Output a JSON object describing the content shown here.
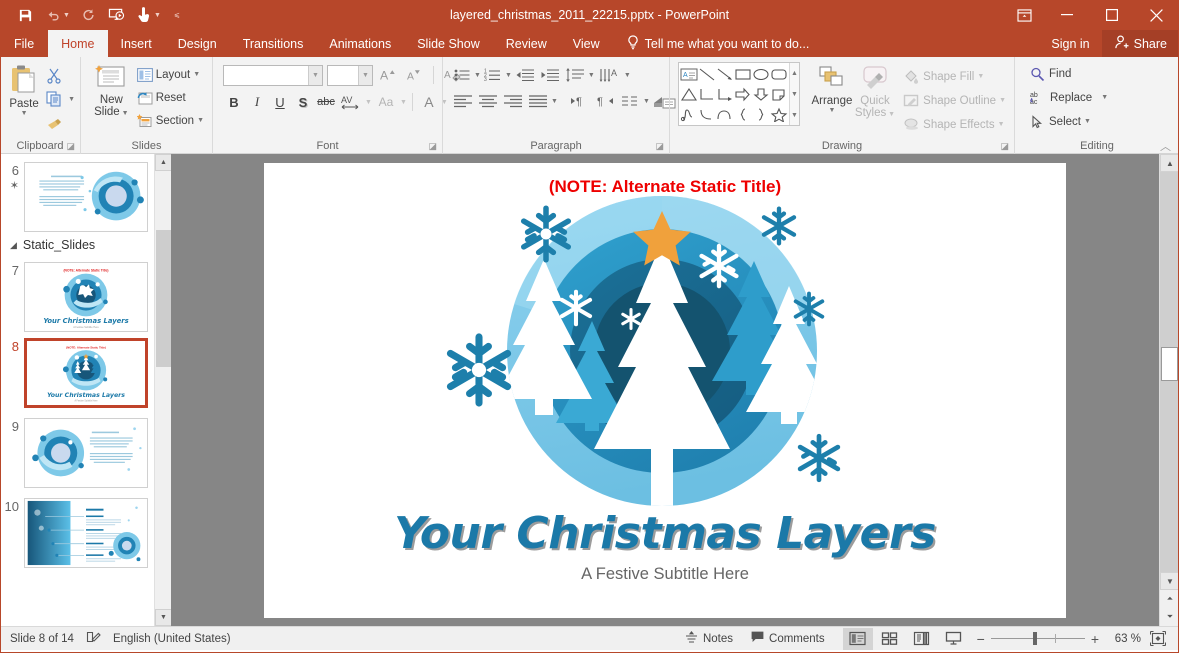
{
  "app": {
    "title": "layered_christmas_2011_22215.pptx - PowerPoint",
    "accent": "#b7472a"
  },
  "quick_access": [
    {
      "name": "save-icon",
      "glyph": "💾",
      "enabled": true
    },
    {
      "name": "undo-icon",
      "glyph": "↶",
      "enabled": false
    },
    {
      "name": "redo-icon",
      "glyph": "↻",
      "enabled": false
    },
    {
      "name": "start-presentation-icon",
      "glyph": "▶",
      "enabled": true
    },
    {
      "name": "touch-mode-icon",
      "glyph": "☝",
      "enabled": true
    }
  ],
  "window_controls": {
    "ribbon_display_options": "Ribbon Display Options",
    "minimize": "Minimize",
    "restore": "Restore Down",
    "close": "Close"
  },
  "tabs": [
    {
      "label": "File",
      "active": false,
      "file": true
    },
    {
      "label": "Home",
      "active": true
    },
    {
      "label": "Insert",
      "active": false
    },
    {
      "label": "Design",
      "active": false
    },
    {
      "label": "Transitions",
      "active": false
    },
    {
      "label": "Animations",
      "active": false
    },
    {
      "label": "Slide Show",
      "active": false
    },
    {
      "label": "Review",
      "active": false
    },
    {
      "label": "View",
      "active": false
    }
  ],
  "tell_me": {
    "label": "Tell me what you want to do..."
  },
  "account": {
    "sign_in": "Sign in",
    "share": "Share"
  },
  "ribbon": {
    "clipboard": {
      "label": "Clipboard",
      "paste": "Paste",
      "cut": "Cut",
      "copy": "Copy",
      "format_painter": "Format Painter"
    },
    "slides": {
      "label": "Slides",
      "new_slide": "New\nSlide",
      "new_slide_line1": "New",
      "new_slide_line2": "Slide",
      "layout": "Layout",
      "reset": "Reset",
      "section": "Section"
    },
    "font": {
      "label": "Font",
      "font_name_value": "",
      "font_name_placeholder": "",
      "font_size_value": "",
      "font_size_placeholder": "",
      "increase_size": "A",
      "decrease_size": "A",
      "clear_formatting": "Clear All Formatting",
      "bold": "B",
      "italic": "I",
      "underline": "U",
      "shadow": "S",
      "strikethrough": "abc",
      "character_spacing": "AV",
      "change_case": "Aa",
      "font_color": "A"
    },
    "paragraph": {
      "label": "Paragraph",
      "bullets": "Bullets",
      "numbering": "Numbering",
      "decrease_indent": "Decrease List Level",
      "increase_indent": "Increase List Level",
      "line_spacing": "Line Spacing",
      "text_direction": "Text Direction",
      "align_text": "Align Text",
      "convert_smartart": "Convert to SmartArt",
      "align_left": "Align Left",
      "center": "Center",
      "align_right": "Align Right",
      "justify": "Justify",
      "columns": "Columns",
      "ltr": "Left-to-Right",
      "rtl": "Right-to-Left"
    },
    "drawing": {
      "label": "Drawing",
      "arrange": "Arrange",
      "quick_styles_line1": "Quick",
      "quick_styles_line2": "Styles",
      "shape_fill": "Shape Fill",
      "shape_outline": "Shape Outline",
      "shape_effects": "Shape Effects"
    },
    "editing": {
      "label": "Editing",
      "find": "Find",
      "replace": "Replace",
      "select": "Select"
    }
  },
  "thumbnails": {
    "items": [
      {
        "number": "6",
        "starred": true,
        "kind": "content-right-circle"
      },
      {
        "number": "7",
        "starred": false,
        "kind": "reindeer"
      },
      {
        "number": "8",
        "starred": false,
        "kind": "trees",
        "selected": true
      },
      {
        "number": "9",
        "starred": false,
        "kind": "content-left-circle"
      },
      {
        "number": "10",
        "starred": false,
        "kind": "bars-list"
      }
    ],
    "section": {
      "label": "Static_Slides",
      "expanded": true
    }
  },
  "slide": {
    "note_title": "(NOTE: Alternate Static Title)",
    "main_title": "Your Christmas Layers",
    "subtitle": "A Festive Subtitle Here",
    "colors": {
      "note_title": "#ee0000",
      "main_title": "#1b79a8",
      "subtitle": "#666666",
      "star": "#f0a13c",
      "ring_outer": "#7ec9e8",
      "ring_mid": "#2e9dcb",
      "ring_inner": "#1c6f96",
      "ring_core": "#17567a",
      "snowflake_dark": "#1d7fab",
      "snowflake_white": "#ffffff"
    }
  },
  "status_bar": {
    "slide_count": "Slide 8 of 14",
    "accessibility_icon": "accessibility-checker",
    "language": "English (United States)",
    "notes": "Notes",
    "comments": "Comments",
    "views": [
      {
        "name": "normal-view",
        "active": true
      },
      {
        "name": "slide-sorter-view",
        "active": false
      },
      {
        "name": "reading-view",
        "active": false
      },
      {
        "name": "slide-show-view",
        "active": false
      }
    ],
    "zoom_out": "−",
    "zoom_in": "+",
    "zoom_level": "63 %",
    "fit_slide": "Fit slide to current window"
  }
}
